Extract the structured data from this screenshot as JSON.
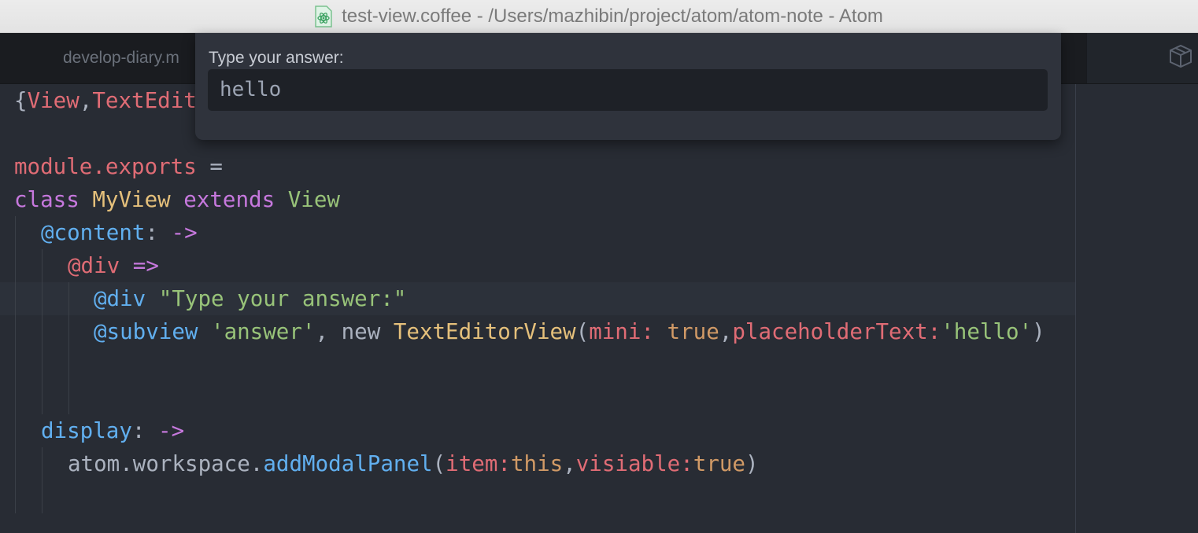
{
  "window": {
    "title": "test-view.coffee - /Users/mazhibin/project/atom/atom-note - Atom",
    "app_icon": "atom-file-icon"
  },
  "tabs": [
    {
      "label": "develop-diary.m"
    }
  ],
  "modal": {
    "label": "Type your answer:",
    "input_value": "hello"
  },
  "code": {
    "line1": {
      "brace": "{",
      "a": "View",
      "comma": ",",
      "b": "TextEdit"
    },
    "line3": {
      "a": "module.exports",
      "b": " ="
    },
    "line4": {
      "kw1": "class ",
      "cls": "MyView",
      "kw2": " extends ",
      "inh": "View"
    },
    "line5": {
      "prop": "@content",
      "plain": ": ",
      "arrow": "->"
    },
    "line6": {
      "var": "@div",
      "sp": " ",
      "arrow": "=>"
    },
    "line7": {
      "prop": "@div",
      "sp": " ",
      "str": "\"Type your answer:\""
    },
    "line8": {
      "prop": "@subview",
      "sp": " ",
      "str1": "'answer'",
      "comma": ", ",
      "kw": "new ",
      "cls": "TextEditorView",
      "paren": "(",
      "k1": "mini:",
      "sp2": " ",
      "v1": "true",
      "comma2": ",",
      "k2": "placeholderText:",
      "str2": "'hello'",
      "close": ")"
    },
    "line11": {
      "prop": "display",
      "plain": ": ",
      "arrow": "->"
    },
    "line12": {
      "obj": "atom.workspace.",
      "fn": "addModalPanel",
      "paren": "(",
      "k1": "item:",
      "v1": "this",
      "comma": ",",
      "k2": "visiable:",
      "v2": "true",
      "close": ")"
    }
  }
}
